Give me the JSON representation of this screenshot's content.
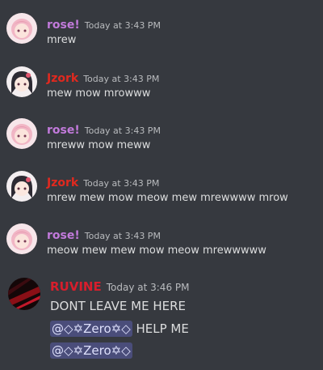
{
  "colors": {
    "background": "#36393f",
    "rose": "#c27adb",
    "jzork": "#e0291f",
    "ruvine": "#d81e2c",
    "timestamp": "#b9bbbe",
    "mention_bg": "#4a4d7a"
  },
  "messages": [
    {
      "author": "rose!",
      "timestamp": "Today at 3:43 PM",
      "text": "mrew"
    },
    {
      "author": "Jzork",
      "timestamp": "Today at 3:43 PM",
      "text": "mew mow mrowww"
    },
    {
      "author": "rose!",
      "timestamp": "Today at 3:43 PM",
      "text": "mreww mow meww"
    },
    {
      "author": "Jzork",
      "timestamp": "Today at 3:43 PM",
      "text": "mrew mew mow meow mew mrewwww mrow"
    },
    {
      "author": "rose!",
      "timestamp": "Today at 3:43 PM",
      "text": "meow mew mew mow meow mrewwwww"
    },
    {
      "author": "RUVINE",
      "timestamp": "Today at 3:46 PM",
      "lines": [
        {
          "text": "DONT LEAVE ME HERE"
        },
        {
          "mention": "@◇✡Zero✡◇",
          "text": " HELP ME"
        },
        {
          "mention": "@◇✡Zero✡◇"
        }
      ]
    }
  ]
}
